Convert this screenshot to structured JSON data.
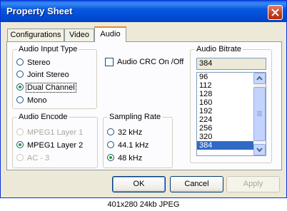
{
  "window": {
    "title": "Property Sheet",
    "close_icon": "close-icon"
  },
  "tabs": [
    {
      "label": "Configurations",
      "active": false
    },
    {
      "label": "Video",
      "active": false
    },
    {
      "label": "Audio",
      "active": true
    }
  ],
  "audio_input_type": {
    "legend": "Audio Input Type",
    "options": [
      "Stereo",
      "Joint Stereo",
      "Dual Channel",
      "Mono"
    ],
    "selected": "Dual Channel"
  },
  "audio_crc": {
    "label": "Audio CRC On /Off",
    "checked": false
  },
  "audio_encode": {
    "legend": "Audio Encode",
    "options": [
      "MPEG1 Layer 1",
      "MPEG1 Layer 2",
      "AC - 3"
    ],
    "selected": "MPEG1 Layer 2"
  },
  "sampling_rate": {
    "legend": "Sampling Rate",
    "options": [
      "32 kHz",
      "44.1 kHz",
      "48 kHz"
    ],
    "selected": "48 kHz"
  },
  "audio_bitrate": {
    "legend": "Audio Bitrate",
    "value": "384",
    "items": [
      "96",
      "112",
      "128",
      "160",
      "192",
      "224",
      "256",
      "320",
      "384"
    ],
    "selected": "384"
  },
  "buttons": {
    "ok": "OK",
    "cancel": "Cancel",
    "apply": "Apply"
  },
  "image_caption": "401x280 24kb JPEG",
  "colors": {
    "title_bar": "#0a5ddf",
    "selection": "#316ac5",
    "tab_highlight": "#e68b2c"
  }
}
